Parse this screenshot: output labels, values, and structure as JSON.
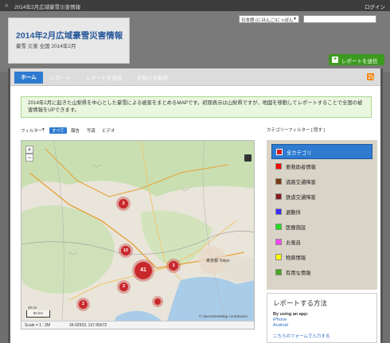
{
  "topbar": {
    "breadcrumb": "2014年2月広域豪雪災害情報",
    "login": "ログイン"
  },
  "header": {
    "title": "2014年2月広域豪雪災害情報",
    "tags": "豪雪  災害  全国  2014年2月",
    "lang_select": "日本語 (にほんご/にっぽん",
    "search_placeholder": "",
    "report_button": "レポートを送信"
  },
  "nav": {
    "items": [
      "ホーム",
      "レポート",
      "レポートを送信",
      "お知らせ取得"
    ]
  },
  "intro": "2014年2月に起きた山梨県を中心とした豪雪による被害をまとめるMAPです。初期表示は山梨県ですが、地図を移動してレポートすることで全国の被害情報をUPできます。",
  "filter": {
    "label": "フィルター：",
    "all": "すべて",
    "news": "報告",
    "photo": "写真",
    "video": "ビデオ"
  },
  "map": {
    "zoom_in": "+",
    "zoom_out": "−",
    "place_tokyo": "東京都 Tokyo",
    "scale_km": "50 km",
    "scale_mi": "20 mi",
    "status_scale": "Scale = 1 : 2M",
    "status_coords": "34.92933, 137.65672",
    "attribution": "© OpenStreetMap contributors",
    "clusters": [
      {
        "count": "3"
      },
      {
        "count": "10"
      },
      {
        "count": "41"
      },
      {
        "count": "3"
      },
      {
        "count": "2"
      },
      {
        "count": "2"
      },
      {
        "count": ""
      }
    ]
  },
  "categories": {
    "filter_label": "カテゴリーフィルター  [ 隠す ]",
    "items": [
      {
        "name": "全カテゴリ",
        "color": "#d11a1a"
      },
      {
        "name": "要救助者情報",
        "color": "#ff0000"
      },
      {
        "name": "道路交通障害",
        "color": "#7a3b10"
      },
      {
        "name": "鉄道交通障害",
        "color": "#8b1a1a"
      },
      {
        "name": "避難所",
        "color": "#3a2cff"
      },
      {
        "name": "医療施設",
        "color": "#22dd22"
      },
      {
        "name": "お風呂",
        "color": "#ff44ff"
      },
      {
        "name": "物資情報",
        "color": "#ffff00"
      },
      {
        "name": "有用な情報",
        "color": "#44aa22"
      }
    ]
  },
  "how_to_report": {
    "title": "レポートする方法",
    "subtitle": "By using an app:",
    "links": [
      "iPhone",
      "Android",
      "こちらのフォームで入力する"
    ]
  }
}
